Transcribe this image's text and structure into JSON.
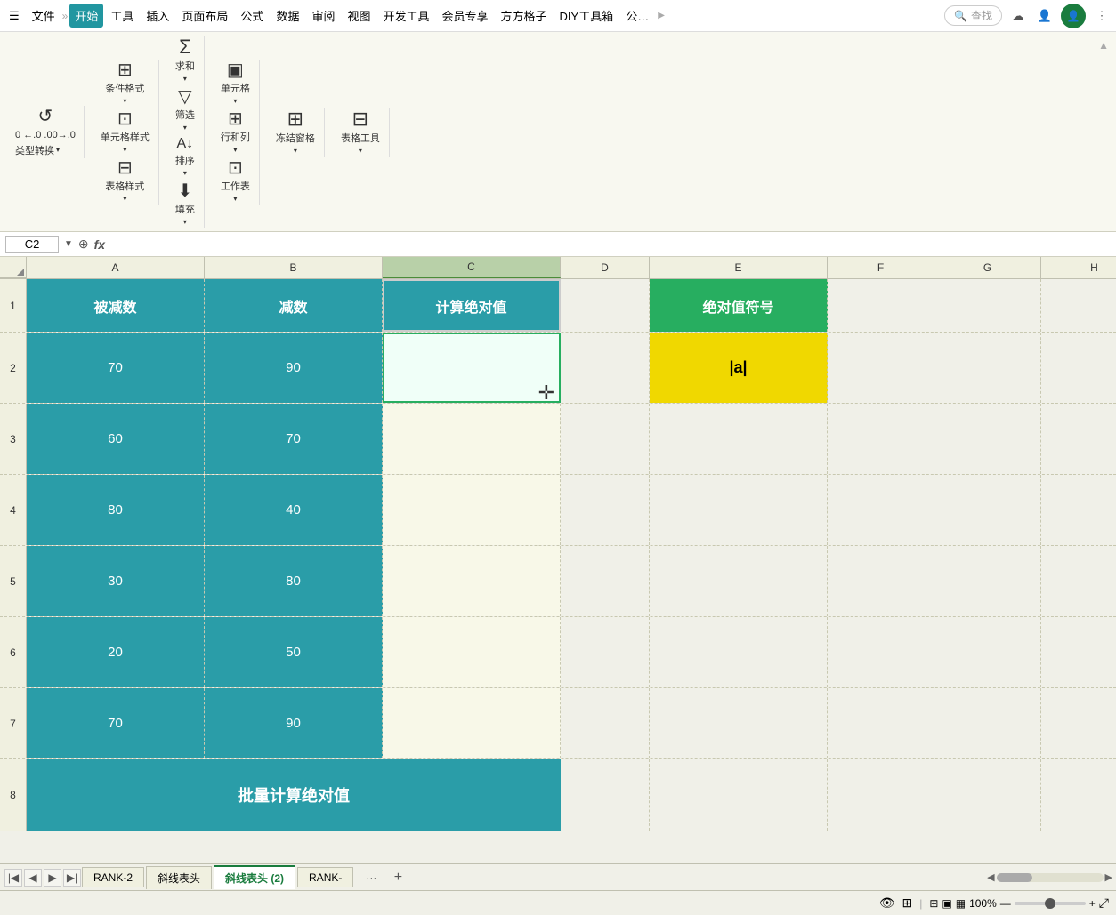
{
  "menubar": {
    "hamburger": "☰",
    "file": "文件",
    "separator": "»",
    "tabs": [
      "开始",
      "工具",
      "插入",
      "页面布局",
      "公式",
      "数据",
      "审阅",
      "视图",
      "开发工具",
      "会员专享",
      "方方格子",
      "DIY工具箱",
      "公…"
    ],
    "active_tab": "开始",
    "search_placeholder": "查找",
    "more_icon": "⋮"
  },
  "ribbon": {
    "groups": [
      {
        "name": "clipboard",
        "buttons": [
          {
            "label": "",
            "icon": "↺",
            "type": "large"
          },
          {
            "label": "0 ←0 .00→.0",
            "icon": "",
            "type": "small-multi"
          },
          {
            "label": "类型转换▾",
            "icon": "",
            "type": "small"
          }
        ]
      },
      {
        "name": "format",
        "buttons": [
          {
            "label": "条件格式▾",
            "icon": "⊞",
            "type": "medium"
          },
          {
            "label": "单元格样式▾",
            "icon": "⊡",
            "type": "medium"
          },
          {
            "label": "表格样式▾",
            "icon": "⊟",
            "type": "medium"
          }
        ]
      },
      {
        "name": "editing",
        "buttons": [
          {
            "label": "求和▾",
            "icon": "Σ",
            "type": "large"
          },
          {
            "label": "筛选▾",
            "icon": "▽",
            "type": "large"
          },
          {
            "label": "排序▾",
            "icon": "A↓",
            "type": "large"
          },
          {
            "label": "填充▾",
            "icon": "⬇",
            "type": "large"
          }
        ]
      },
      {
        "name": "cells",
        "buttons": [
          {
            "label": "单元格▾",
            "icon": "▣",
            "type": "large"
          },
          {
            "label": "行和列▾",
            "icon": "⊞",
            "type": "large"
          },
          {
            "label": "工作表▾",
            "icon": "⊡",
            "type": "large"
          }
        ]
      },
      {
        "name": "freeze",
        "buttons": [
          {
            "label": "冻结窗格▾",
            "icon": "⊞",
            "type": "large"
          }
        ]
      },
      {
        "name": "table",
        "buttons": [
          {
            "label": "表格工具▾",
            "icon": "⊟",
            "type": "large"
          }
        ]
      }
    ]
  },
  "formula_bar": {
    "cell_ref": "C2",
    "fx_label": "fx"
  },
  "columns": {
    "headers": [
      "A",
      "B",
      "C",
      "D",
      "E",
      "F",
      "G",
      "H"
    ],
    "widths": [
      200,
      200,
      200,
      100,
      200,
      120,
      120,
      120
    ]
  },
  "grid": {
    "rows": [
      {
        "row_num": "1",
        "cells": [
          {
            "col": "A",
            "value": "被减数",
            "style": "teal-header"
          },
          {
            "col": "B",
            "value": "减数",
            "style": "teal-header"
          },
          {
            "col": "C",
            "value": "计算绝对值",
            "style": "teal-header-selected"
          },
          {
            "col": "D",
            "value": "",
            "style": "normal"
          },
          {
            "col": "E",
            "value": "绝对值符号",
            "style": "green-header"
          },
          {
            "col": "F",
            "value": "",
            "style": "normal"
          },
          {
            "col": "G",
            "value": "",
            "style": "normal"
          },
          {
            "col": "H",
            "value": "",
            "style": "normal"
          }
        ]
      },
      {
        "row_num": "2",
        "cells": [
          {
            "col": "A",
            "value": "70",
            "style": "teal-data"
          },
          {
            "col": "B",
            "value": "90",
            "style": "teal-data"
          },
          {
            "col": "C",
            "value": "",
            "style": "selected-cell"
          },
          {
            "col": "D",
            "value": "",
            "style": "normal"
          },
          {
            "col": "E",
            "value": "|a|",
            "style": "yellow-data"
          },
          {
            "col": "F",
            "value": "",
            "style": "normal"
          },
          {
            "col": "G",
            "value": "",
            "style": "normal"
          },
          {
            "col": "H",
            "value": "",
            "style": "normal"
          }
        ]
      },
      {
        "row_num": "3",
        "cells": [
          {
            "col": "A",
            "value": "60",
            "style": "teal-data"
          },
          {
            "col": "B",
            "value": "70",
            "style": "teal-data"
          },
          {
            "col": "C",
            "value": "",
            "style": "c-col"
          },
          {
            "col": "D",
            "value": "",
            "style": "normal"
          },
          {
            "col": "E",
            "value": "",
            "style": "normal"
          },
          {
            "col": "F",
            "value": "",
            "style": "normal"
          },
          {
            "col": "G",
            "value": "",
            "style": "normal"
          },
          {
            "col": "H",
            "value": "",
            "style": "normal"
          }
        ]
      },
      {
        "row_num": "4",
        "cells": [
          {
            "col": "A",
            "value": "80",
            "style": "teal-data"
          },
          {
            "col": "B",
            "value": "40",
            "style": "teal-data"
          },
          {
            "col": "C",
            "value": "",
            "style": "c-col"
          },
          {
            "col": "D",
            "value": "",
            "style": "normal"
          },
          {
            "col": "E",
            "value": "",
            "style": "normal"
          },
          {
            "col": "F",
            "value": "",
            "style": "normal"
          },
          {
            "col": "G",
            "value": "",
            "style": "normal"
          },
          {
            "col": "H",
            "value": "",
            "style": "normal"
          }
        ]
      },
      {
        "row_num": "5",
        "cells": [
          {
            "col": "A",
            "value": "30",
            "style": "teal-data"
          },
          {
            "col": "B",
            "value": "80",
            "style": "teal-data"
          },
          {
            "col": "C",
            "value": "",
            "style": "c-col"
          },
          {
            "col": "D",
            "value": "",
            "style": "normal"
          },
          {
            "col": "E",
            "value": "",
            "style": "normal"
          },
          {
            "col": "F",
            "value": "",
            "style": "normal"
          },
          {
            "col": "G",
            "value": "",
            "style": "normal"
          },
          {
            "col": "H",
            "value": "",
            "style": "normal"
          }
        ]
      },
      {
        "row_num": "6",
        "cells": [
          {
            "col": "A",
            "value": "20",
            "style": "teal-data"
          },
          {
            "col": "B",
            "value": "50",
            "style": "teal-data"
          },
          {
            "col": "C",
            "value": "",
            "style": "c-col"
          },
          {
            "col": "D",
            "value": "",
            "style": "normal"
          },
          {
            "col": "E",
            "value": "",
            "style": "normal"
          },
          {
            "col": "F",
            "value": "",
            "style": "normal"
          },
          {
            "col": "G",
            "value": "",
            "style": "normal"
          },
          {
            "col": "H",
            "value": "",
            "style": "normal"
          }
        ]
      },
      {
        "row_num": "7",
        "cells": [
          {
            "col": "A",
            "value": "70",
            "style": "teal-data"
          },
          {
            "col": "B",
            "value": "90",
            "style": "teal-data"
          },
          {
            "col": "C",
            "value": "",
            "style": "c-col"
          },
          {
            "col": "D",
            "value": "",
            "style": "normal"
          },
          {
            "col": "E",
            "value": "",
            "style": "normal"
          },
          {
            "col": "F",
            "value": "",
            "style": "normal"
          },
          {
            "col": "G",
            "value": "",
            "style": "normal"
          },
          {
            "col": "H",
            "value": "",
            "style": "normal"
          }
        ]
      },
      {
        "row_num": "8",
        "cells": [
          {
            "col": "ABC_merged",
            "value": "批量计算绝对值",
            "style": "teal-merged"
          },
          {
            "col": "D",
            "value": "",
            "style": "normal"
          },
          {
            "col": "E",
            "value": "",
            "style": "normal"
          },
          {
            "col": "F",
            "value": "",
            "style": "normal"
          },
          {
            "col": "G",
            "value": "",
            "style": "normal"
          },
          {
            "col": "H",
            "value": "",
            "style": "normal"
          }
        ]
      }
    ]
  },
  "sheet_tabs": {
    "tabs": [
      "RANK-2",
      "斜线表头",
      "斜线表头 (2)",
      "RANK-"
    ],
    "active_tab": "斜线表头 (2)",
    "more": "···"
  },
  "status_bar": {
    "zoom_level": "100%",
    "view_icons": [
      "⊞",
      "▣",
      "▦"
    ]
  },
  "colors": {
    "teal": "#2a9da8",
    "green": "#27ae60",
    "yellow": "#f0d800",
    "selected_outline": "#27ae60",
    "light_bg": "#f8f8e8"
  }
}
